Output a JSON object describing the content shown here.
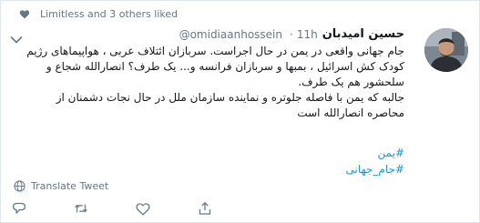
{
  "social_context": {
    "text": "Limitless and 3 others liked",
    "icon": "heart-icon"
  },
  "tweet": {
    "author_name": "حسین امیدبان",
    "handle": "@omidiaanhossein",
    "separator": "·",
    "time": "11h",
    "text_paragraph_1": "جام جهانی واقعی در یمن در حال اجراست. سربازان ائتلاف عربی ، هواپیماهای رژیم کودک کش اسرائیل ، بمبها و سربازان فرانسه و... یک طرف؟ انصارالله شجاع و سلحشور هم یک طرف.",
    "text_paragraph_2": "جالبه که یمن با فاصله جلوتره و نماینده سازمان ملل در حال نجات دشمنان از محاصره انصارالله است",
    "hashtags": [
      "#یمن",
      "#جام_جهانی"
    ]
  },
  "translate_label": "Translate Tweet",
  "icons": {
    "caret": "chevron-down-icon",
    "translate": "globe-icon",
    "reply": "reply-icon",
    "retweet": "retweet-icon",
    "like": "heart-icon",
    "share": "share-icon"
  },
  "colors": {
    "link": "#1b95e0",
    "muted": "#657786",
    "text": "#14171a",
    "border": "#e1e8ed"
  }
}
